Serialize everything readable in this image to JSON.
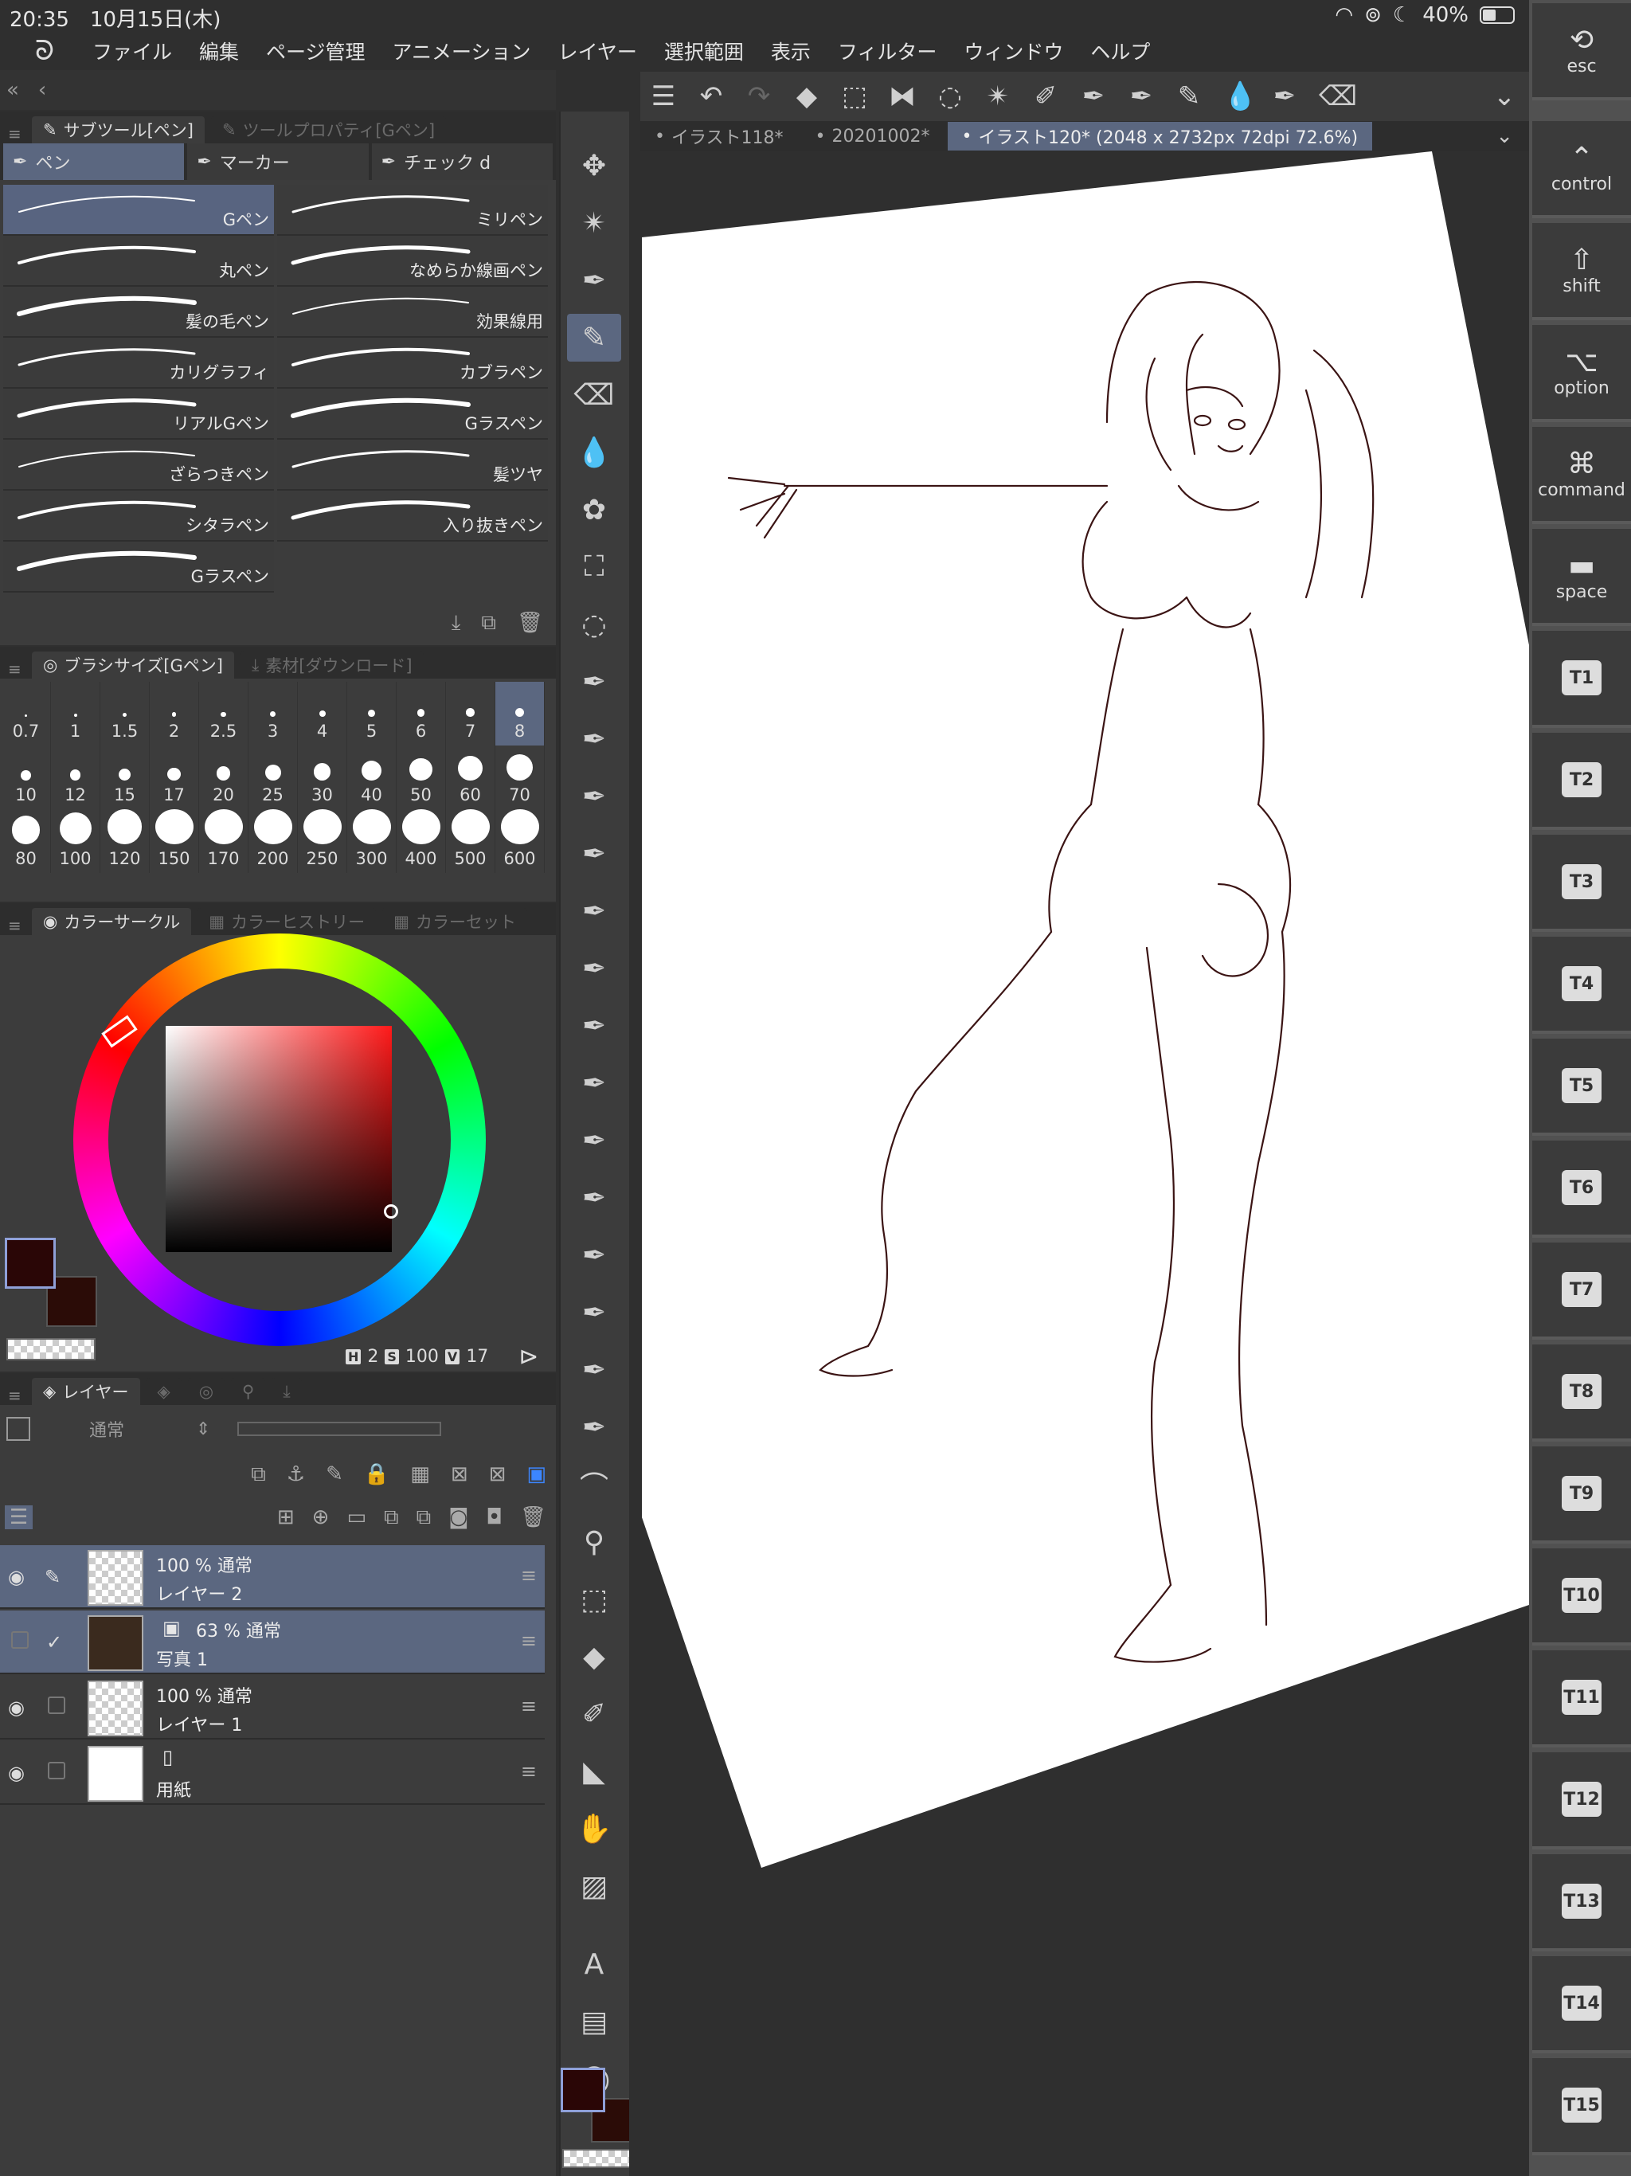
{
  "status": {
    "time": "20:35",
    "date": "10月15日(木)",
    "battery": "40%"
  },
  "menu": [
    "ファイル",
    "編集",
    "ページ管理",
    "アニメーション",
    "レイヤー",
    "選択範囲",
    "表示",
    "フィルター",
    "ウィンドウ",
    "ヘルプ"
  ],
  "subtool": {
    "tab_active": "サブツール[ペン]",
    "tab_inactive": "ツールプロパティ[Gペン]",
    "categories": [
      "ペン",
      "マーカー",
      "チェック d"
    ],
    "brushes": [
      "Gペン",
      "ミリペン",
      "丸ペン",
      "なめらか線画ペン",
      "髪の毛ペン",
      "効果線用",
      "カリグラフィ",
      "カブラペン",
      "リアルGペン",
      "Gラスペン",
      "ざらつきペン",
      "髪ツヤ",
      "シタラペン",
      "入り抜きペン",
      "Gラスペン"
    ],
    "selected": "Gペン"
  },
  "brushsize": {
    "tab_active": "ブラシサイズ[Gペン]",
    "tab_inactive": "素材[ダウンロード]",
    "sizes": [
      "0.7",
      "1",
      "1.5",
      "2",
      "2.5",
      "3",
      "4",
      "5",
      "6",
      "7",
      "8",
      "10",
      "12",
      "15",
      "17",
      "20",
      "25",
      "30",
      "40",
      "50",
      "60",
      "70",
      "80",
      "100",
      "120",
      "150",
      "170",
      "200",
      "250",
      "300",
      "400",
      "500",
      "600"
    ],
    "selected": "8"
  },
  "color": {
    "tab_active": "カラーサークル",
    "tab_history": "カラーヒストリー",
    "tab_set": "カラーセット",
    "main": "#2a0606",
    "sub": "#2b0c07",
    "h_label": "H",
    "h": "2",
    "s_label": "S",
    "s": "100",
    "v_label": "V",
    "v": "17"
  },
  "layers": {
    "tab": "レイヤー",
    "blend": "通常",
    "items": [
      {
        "opacity": "100 % 通常",
        "name": "レイヤー 2",
        "selected": true
      },
      {
        "opacity": "63 % 通常",
        "name": "写真 1",
        "selected": true
      },
      {
        "opacity": "100 % 通常",
        "name": "レイヤー 1",
        "selected": false
      },
      {
        "opacity": "",
        "name": "用紙",
        "selected": false
      }
    ]
  },
  "doc_tabs": [
    "イラスト118*",
    "20201002*",
    "イラスト120* (2048 x 2732px 72dpi 72.6%)"
  ],
  "vkeys": [
    {
      "icon": "esc-icon",
      "glyph": "⟲",
      "label": "esc"
    },
    {
      "icon": "control-icon",
      "glyph": "⌃",
      "label": "control"
    },
    {
      "icon": "shift-icon",
      "glyph": "⇧",
      "label": "shift"
    },
    {
      "icon": "option-icon",
      "glyph": "⌥",
      "label": "option"
    },
    {
      "icon": "command-icon",
      "glyph": "⌘",
      "label": "command"
    },
    {
      "icon": "space-icon",
      "glyph": "▬",
      "label": "space"
    }
  ],
  "tkeys": [
    "T1",
    "T2",
    "T3",
    "T4",
    "T5",
    "T6",
    "T7",
    "T8",
    "T9",
    "T10",
    "T11",
    "T12",
    "T13",
    "T14",
    "T15"
  ]
}
